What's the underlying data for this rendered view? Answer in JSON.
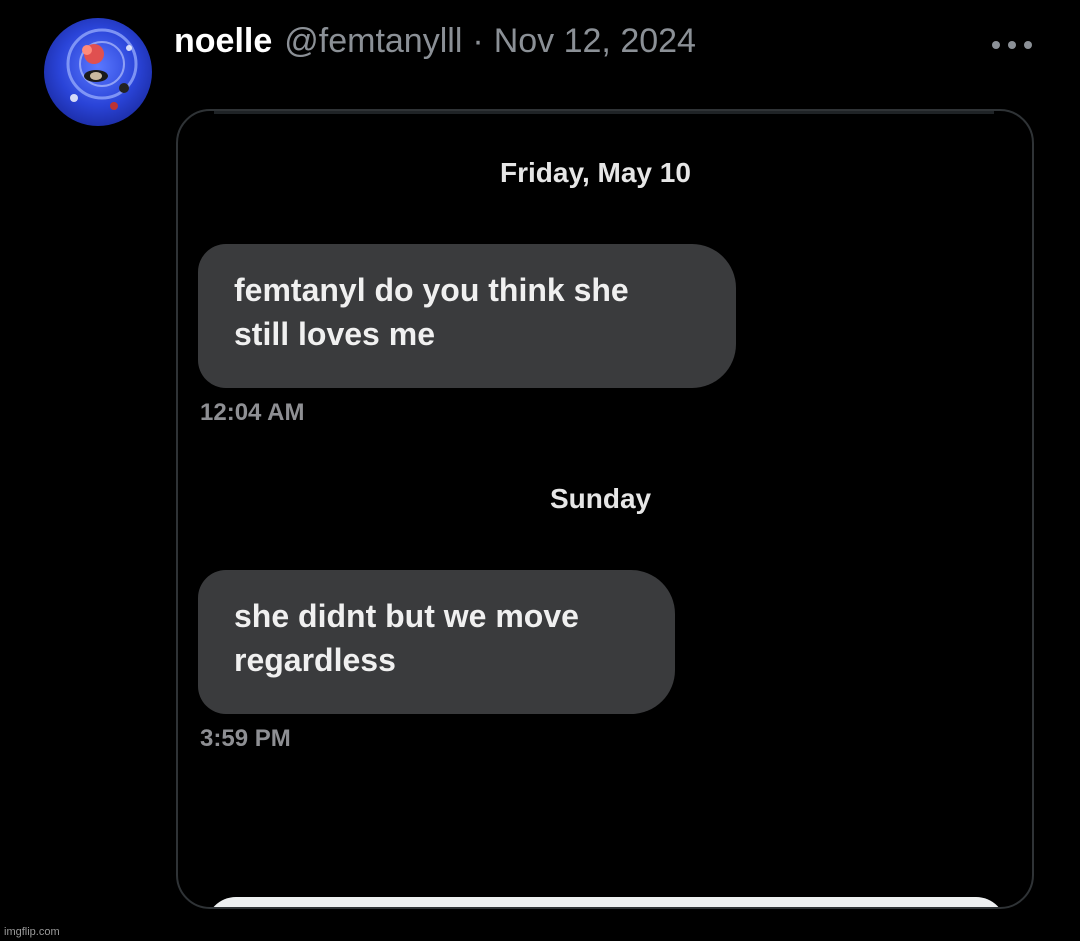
{
  "post": {
    "display_name": "noelle",
    "handle": "@femtanylll",
    "separator": "·",
    "date": "Nov 12, 2024"
  },
  "icons": {
    "avatar": "avatar-image",
    "more": "more-options-icon"
  },
  "media": {
    "conversation": [
      {
        "day": "Friday, May 10",
        "lines": [
          "femtanyl do you think she",
          "still loves me"
        ],
        "time": "12:04 AM"
      },
      {
        "day": "Sunday",
        "lines": [
          "she didnt but we move",
          "regardless"
        ],
        "time": "3:59 PM"
      }
    ]
  },
  "watermark": "imgflip.com",
  "colors": {
    "background": "#000000",
    "bubble": "#3a3b3d",
    "muted_text": "#8b9096"
  }
}
